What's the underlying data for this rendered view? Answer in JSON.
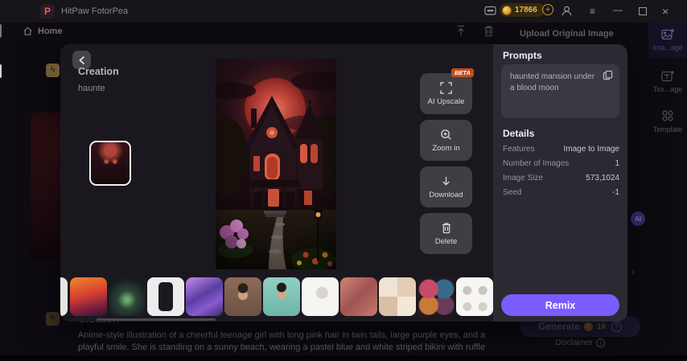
{
  "titlebar": {
    "app_name": "HitPaw FotorPea",
    "credits": "17866"
  },
  "nav": {
    "home_label": "Home"
  },
  "content": {
    "upload_title": "Upload Original Image",
    "creations": [
      {
        "title": "Creation",
        "prompt_snippet": "haunte"
      },
      {
        "title": "Creation",
        "prompt": "Anime-style illustration of a cheerful teenage girl with long pink hair in twin tails, large purple eyes, and a playful smile. She is standing on a sunny beach, wearing a pastel blue and white striped bikini with ruffle details"
      }
    ],
    "generate": {
      "label": "Generate",
      "cost": "16"
    },
    "disclaimer_label": "Disclaimer",
    "info_glyph": "i",
    "help_glyph": "?",
    "ai_badge": "AI"
  },
  "sidebar": {
    "items": [
      {
        "label": "Ima...age",
        "selected": true
      },
      {
        "label": "Tex...age",
        "selected": false
      },
      {
        "label": "Template",
        "selected": false
      }
    ]
  },
  "modal": {
    "actions": [
      {
        "label": "AI Upscale",
        "badge": "BETA"
      },
      {
        "label": "Zoom in"
      },
      {
        "label": "Download"
      },
      {
        "label": "Delete"
      }
    ],
    "prompts": {
      "title": "Prompts",
      "text": "haunted mansion under a blood moon"
    },
    "details": {
      "title": "Details",
      "rows": [
        {
          "label": "Features",
          "value": "Image to Image"
        },
        {
          "label": "Number of Images",
          "value": "1"
        },
        {
          "label": "Image Size",
          "value": "573,1024"
        },
        {
          "label": "Seed",
          "value": "-1"
        }
      ]
    },
    "remix_label": "Remix",
    "thumbnails": [
      "sunset-figure",
      "graveyard-spirit",
      "phone-product",
      "purple-crystals",
      "portrait-man-brick",
      "portrait-man-teal",
      "face-sketch",
      "mermaid-collage",
      "sticker-sheet",
      "badge-set",
      "face-sketches"
    ]
  },
  "colors": {
    "accent_purple": "#7b5cff",
    "beta_orange": "#bf4f1d",
    "coin_gold": "#e9b84a",
    "sidebar_selected": "#7e6ef2"
  }
}
